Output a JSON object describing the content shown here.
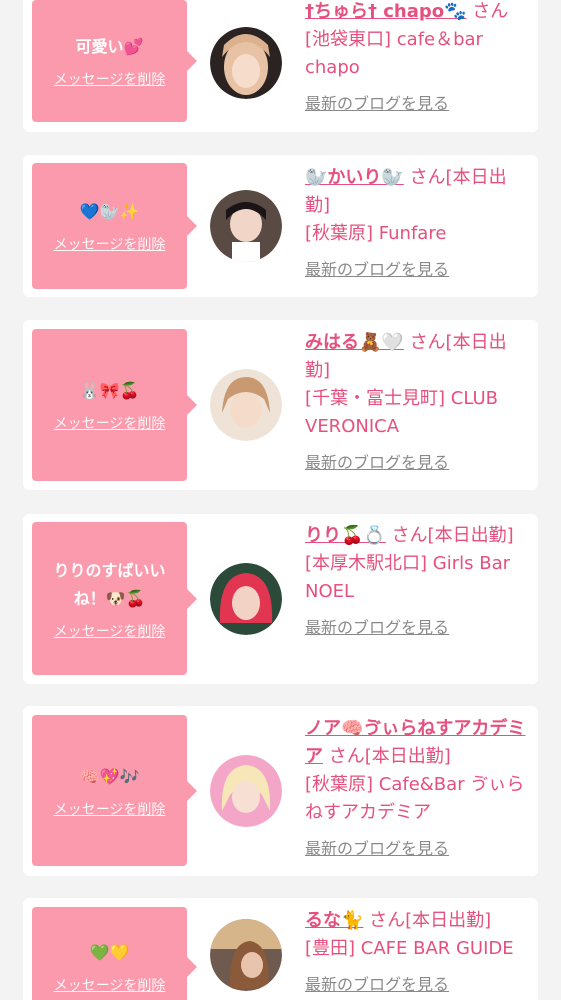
{
  "delete_label": "メッセージを削除",
  "blog_label": "最新のブログを見る",
  "entries": [
    {
      "message": "可愛い💕",
      "name": "†ちゅら† chapo🐾",
      "suffix": "さん",
      "shop": "[池袋東口] cafe＆bar chapo"
    },
    {
      "message": "💙🦭✨",
      "name": "🦭かいり🦭",
      "suffix": "さん[本日出勤]",
      "shop": "[秋葉原] Funfare"
    },
    {
      "message": "🐰🎀🍒",
      "name": "みはる🧸🤍",
      "suffix": "さん[本日出勤]",
      "shop": "[千葉・富士見町] CLUB VERONICA"
    },
    {
      "message": "りりのすばいいね！🐶🍒",
      "name": "りり🍒💍",
      "suffix": "さん[本日出勤]",
      "shop": "[本厚木駅北口] Girls Bar NOEL"
    },
    {
      "message": "🧠💖🎶",
      "name": "ノア🧠ゔぃらねすアカデミア",
      "suffix": "さん[本日出勤]",
      "shop": "[秋葉原] Cafe&Bar ゔぃらねすアカデミア"
    },
    {
      "message": "💚💛",
      "name": "るな🐈",
      "suffix": "さん[本日出勤]",
      "shop": "[豊田] CAFE BAR GUIDE"
    }
  ]
}
